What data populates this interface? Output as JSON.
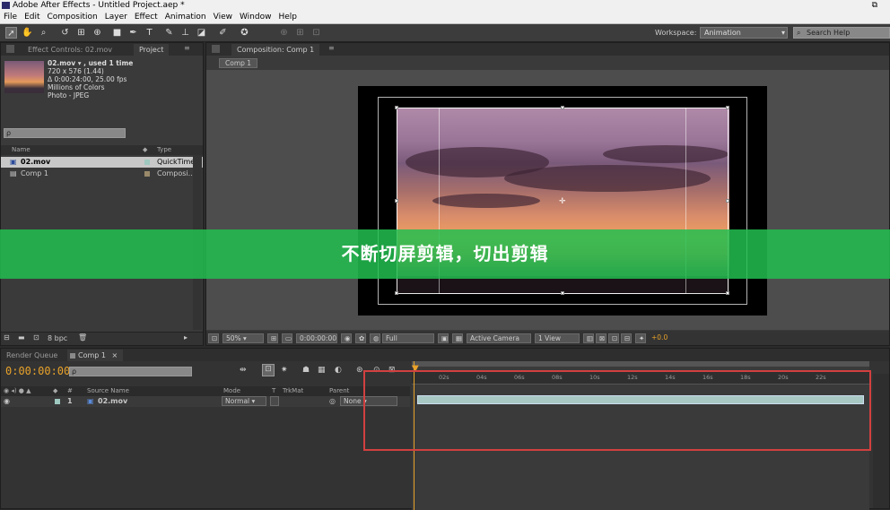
{
  "window": {
    "title": "Adobe After Effects - Untitled Project.aep *",
    "restore_glyph": "⧉"
  },
  "menu": [
    "File",
    "Edit",
    "Composition",
    "Layer",
    "Effect",
    "Animation",
    "View",
    "Window",
    "Help"
  ],
  "toolbar": {
    "workspace_label": "Workspace:",
    "workspace_value": "Animation",
    "search_placeholder": "Search Help",
    "tools": [
      "selection-tool",
      "hand-tool",
      "zoom-tool",
      "rotate-tool",
      "camera-orbit-tool",
      "pan-behind-tool",
      "rectangle-tool",
      "pen-tool",
      "text-tool",
      "brush-tool",
      "clone-stamp-tool",
      "eraser-tool",
      "roto-brush-tool",
      "puppet-pin-tool"
    ]
  },
  "project_panel": {
    "tabs": [
      "Effect Controls: 02.mov",
      "Project"
    ],
    "footage_info": [
      "02.mov ▾ , used 1 time",
      "720 x 576 (1.44)",
      "Δ 0:00:24:00, 25.00 fps",
      "Millions of Colors",
      "Photo - JPEG"
    ],
    "search_placeholder": "ρ",
    "columns": [
      "Name",
      "Type"
    ],
    "items": [
      {
        "name": "02.mov",
        "type": "QuickTime",
        "selected": true
      },
      {
        "name": "Comp 1",
        "type": "Composi...",
        "selected": false
      }
    ],
    "bpc": "8 bpc"
  },
  "composition_panel": {
    "tab": "Composition: Comp 1",
    "flowchart_tab": "Comp 1",
    "zoom": "50%",
    "timecode": "0:00:00:00",
    "resolution": "Full",
    "camera": "Active Camera",
    "views": "1 View",
    "exposure": "+0.0"
  },
  "overlay": {
    "text": "不断切屏剪辑，切出剪辑",
    "color": "#22be50"
  },
  "timeline": {
    "tabs": [
      "Render Queue",
      "Comp 1"
    ],
    "timecode": "0:00:00:00",
    "search_placeholder": "ρ",
    "columns": [
      "#",
      "Source Name",
      "Mode",
      "T",
      "TrkMat",
      "Parent"
    ],
    "layers": [
      {
        "number": "1",
        "name": "02.mov",
        "mode": "Normal",
        "parent": "None"
      }
    ],
    "ruler_labels": [
      "0s",
      "02s",
      "04s",
      "06s",
      "08s",
      "10s",
      "12s",
      "14s",
      "16s",
      "18s",
      "20s",
      "22s"
    ]
  },
  "colors": {
    "accent": "#e8a22a",
    "highlight": "#d24040",
    "overlay": "#22be50"
  }
}
